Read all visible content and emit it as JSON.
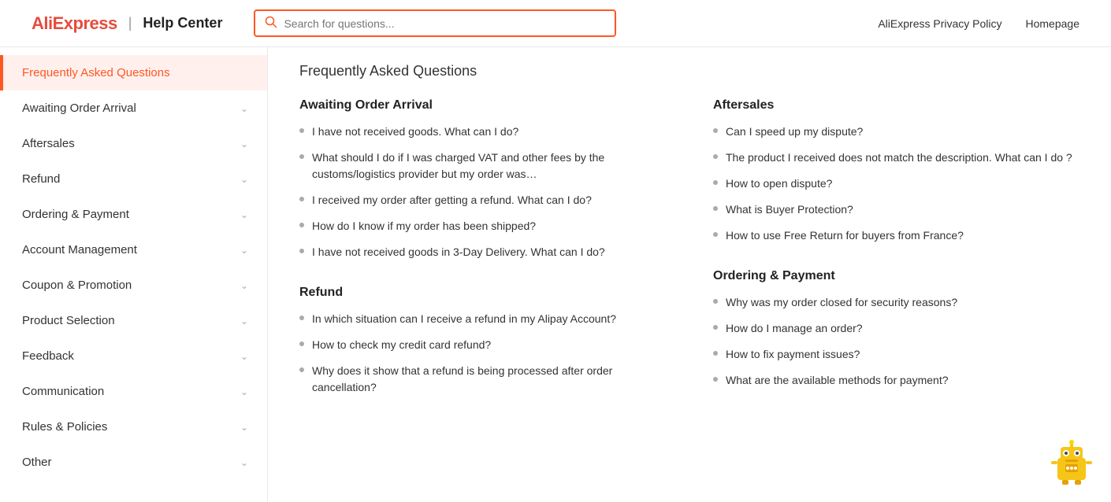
{
  "header": {
    "logo_aliexpress": "AliExpress",
    "logo_separator": "|",
    "logo_helpcenter": "Help Center",
    "search_placeholder": "Search for questions...",
    "nav_links": [
      {
        "id": "privacy",
        "label": "AliExpress Privacy Policy"
      },
      {
        "id": "homepage",
        "label": "Homepage"
      }
    ]
  },
  "sidebar": {
    "items": [
      {
        "id": "faq",
        "label": "Frequently Asked Questions",
        "active": true
      },
      {
        "id": "awaiting",
        "label": "Awaiting Order Arrival",
        "active": false
      },
      {
        "id": "aftersales",
        "label": "Aftersales",
        "active": false
      },
      {
        "id": "refund",
        "label": "Refund",
        "active": false
      },
      {
        "id": "ordering",
        "label": "Ordering & Payment",
        "active": false
      },
      {
        "id": "account",
        "label": "Account Management",
        "active": false
      },
      {
        "id": "coupon",
        "label": "Coupon & Promotion",
        "active": false
      },
      {
        "id": "product",
        "label": "Product Selection",
        "active": false
      },
      {
        "id": "feedback",
        "label": "Feedback",
        "active": false
      },
      {
        "id": "communication",
        "label": "Communication",
        "active": false
      },
      {
        "id": "rules",
        "label": "Rules & Policies",
        "active": false
      },
      {
        "id": "other",
        "label": "Other",
        "active": false
      }
    ]
  },
  "main": {
    "page_title": "Frequently Asked Questions",
    "sections": [
      {
        "id": "awaiting-section",
        "title": "Awaiting Order Arrival",
        "column": 0,
        "items": [
          "I have not received goods. What can I do?",
          "What should I do if I was charged VAT and other fees by the customs/logistics provider but my order was…",
          "I received my order after getting a refund. What can I do?",
          "How do I know if my order has been shipped?",
          "I have not received goods in 3-Day Delivery. What can I do?"
        ]
      },
      {
        "id": "aftersales-section",
        "title": "Aftersales",
        "column": 1,
        "items": [
          "Can I speed up my dispute?",
          "The product I received does not match the description. What can I do ?",
          "How to open dispute?",
          "What is Buyer Protection?",
          "How to use Free Return for buyers from France?"
        ]
      },
      {
        "id": "refund-section",
        "title": "Refund",
        "column": 0,
        "items": [
          "In which situation can I receive a refund in my Alipay Account?",
          "How to check my credit card refund?",
          "Why does it show that a refund is being processed after order cancellation?"
        ]
      },
      {
        "id": "ordering-section",
        "title": "Ordering & Payment",
        "column": 1,
        "items": [
          "Why was my order closed for security reasons?",
          "How do I manage an order?",
          "How to fix payment issues?",
          "What are the available methods for payment?"
        ]
      }
    ]
  }
}
